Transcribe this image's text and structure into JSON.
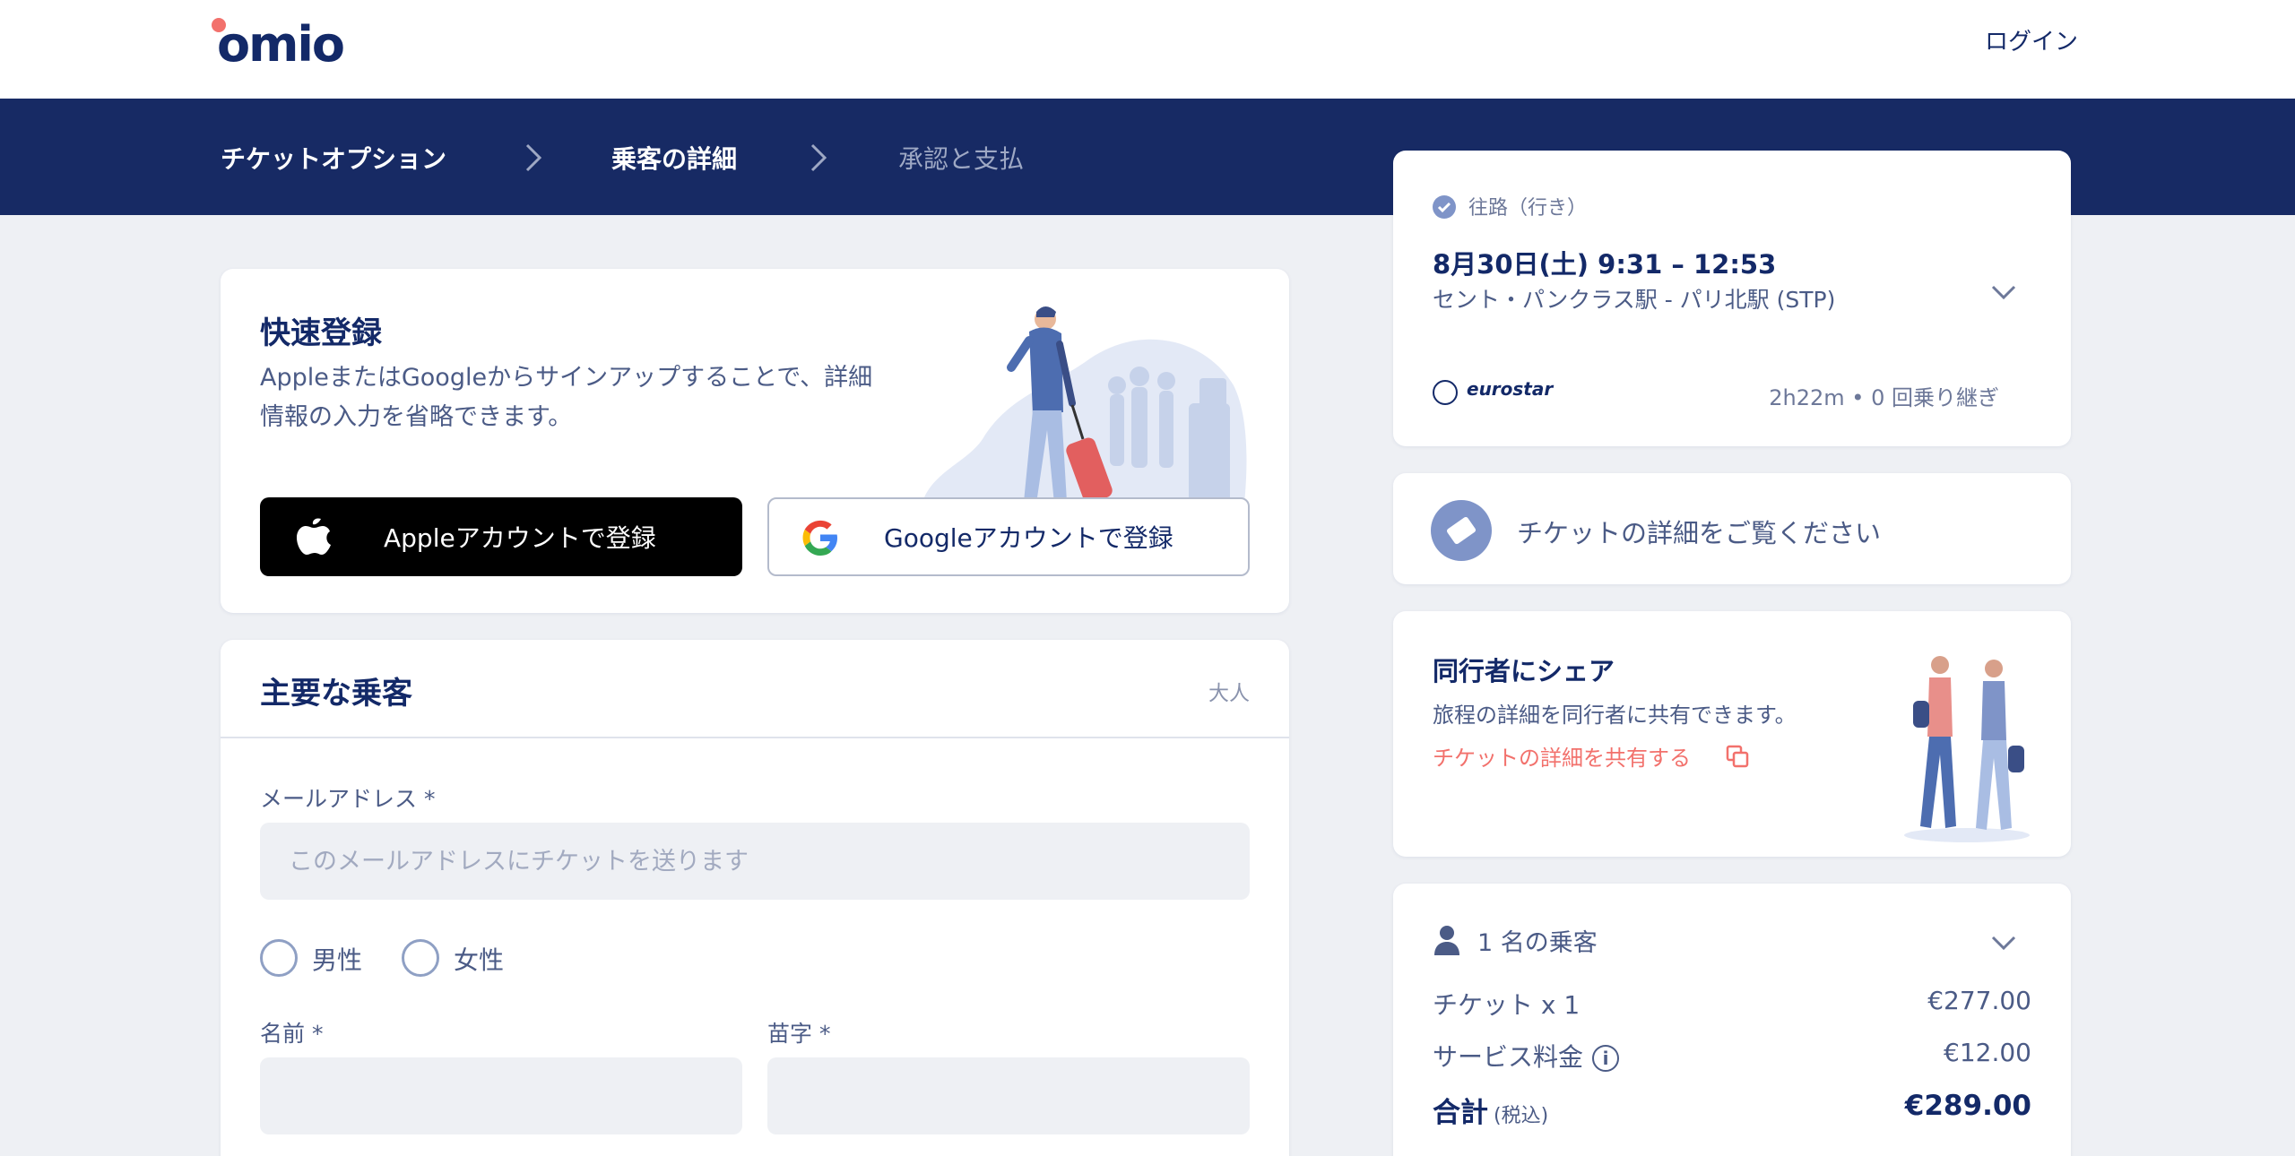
{
  "header": {
    "logo": "omio",
    "login_label": "ログイン"
  },
  "steps": [
    {
      "label": "チケットオプション",
      "state": "done"
    },
    {
      "label": "乗客の詳細",
      "state": "current"
    },
    {
      "label": "承認と支払",
      "state": "upcoming"
    }
  ],
  "quick_register": {
    "title": "快速登録",
    "description": "AppleまたはGoogleからサインアップすることで、詳細情報の入力を省略できます。",
    "apple_button": "Appleアカウントで登録",
    "google_button": "Googleアカウントで登録"
  },
  "main_passenger": {
    "title": "主要な乗客",
    "badge": "大人",
    "email_label": "メールアドレス *",
    "email_placeholder": "このメールアドレスにチケットを送ります",
    "gender_male": "男性",
    "gender_female": "女性",
    "first_name_label": "名前 *",
    "last_name_label": "苗字 *"
  },
  "journey": {
    "direction": "往路（行き）",
    "datetime": "8月30日(土)   9:31 – 12:53",
    "route": "セント・パンクラス駅    -  パリ北駅 (STP)",
    "carrier": "eurostar",
    "duration": "2h22m • 0 回乗り継ぎ"
  },
  "ticket_details": {
    "label": "チケットの詳細をご覧ください"
  },
  "share": {
    "title": "同行者にシェア",
    "description": "旅程の詳細を同行者に共有できます。",
    "link": "チケットの詳細を共有する"
  },
  "summary": {
    "passengers": "1 名の乗客",
    "ticket_label": "チケット x 1",
    "ticket_price": "€277.00",
    "service_label": "サービス料金",
    "service_price": "€12.00",
    "total_label": "合計",
    "total_tax": "(税込)",
    "total_price": "€289.00"
  },
  "colors": {
    "brand_navy": "#172a64",
    "accent_coral": "#f2716c",
    "page_bg": "#eef0f4"
  }
}
